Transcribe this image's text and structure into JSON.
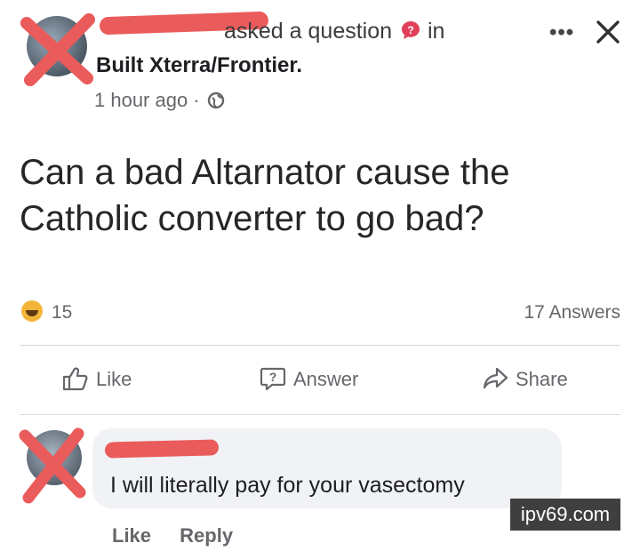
{
  "post": {
    "asked_text": "asked a question",
    "in_text": "in",
    "group": "Built Xterra/Frontier.",
    "time": "1 hour ago ·",
    "question": "Can a bad Altarnator cause the Catholic converter to go bad?",
    "reaction_count": "15",
    "answers_label": "17 Answers"
  },
  "actions": {
    "like": "Like",
    "answer": "Answer",
    "share": "Share"
  },
  "comment": {
    "text": "I will literally pay for your vasectomy",
    "like": "Like",
    "reply": "Reply"
  },
  "watermark": "ipv69.com",
  "colors": {
    "redaction": "#ea5b5b",
    "text_secondary": "#65676b",
    "reaction_emoji": "#f2b53a"
  },
  "icons": [
    "more-icon",
    "close-icon",
    "question-bubble-icon",
    "globe-icon",
    "thumbs-up-icon",
    "answer-icon",
    "share-icon",
    "laughing-emoji-icon"
  ]
}
